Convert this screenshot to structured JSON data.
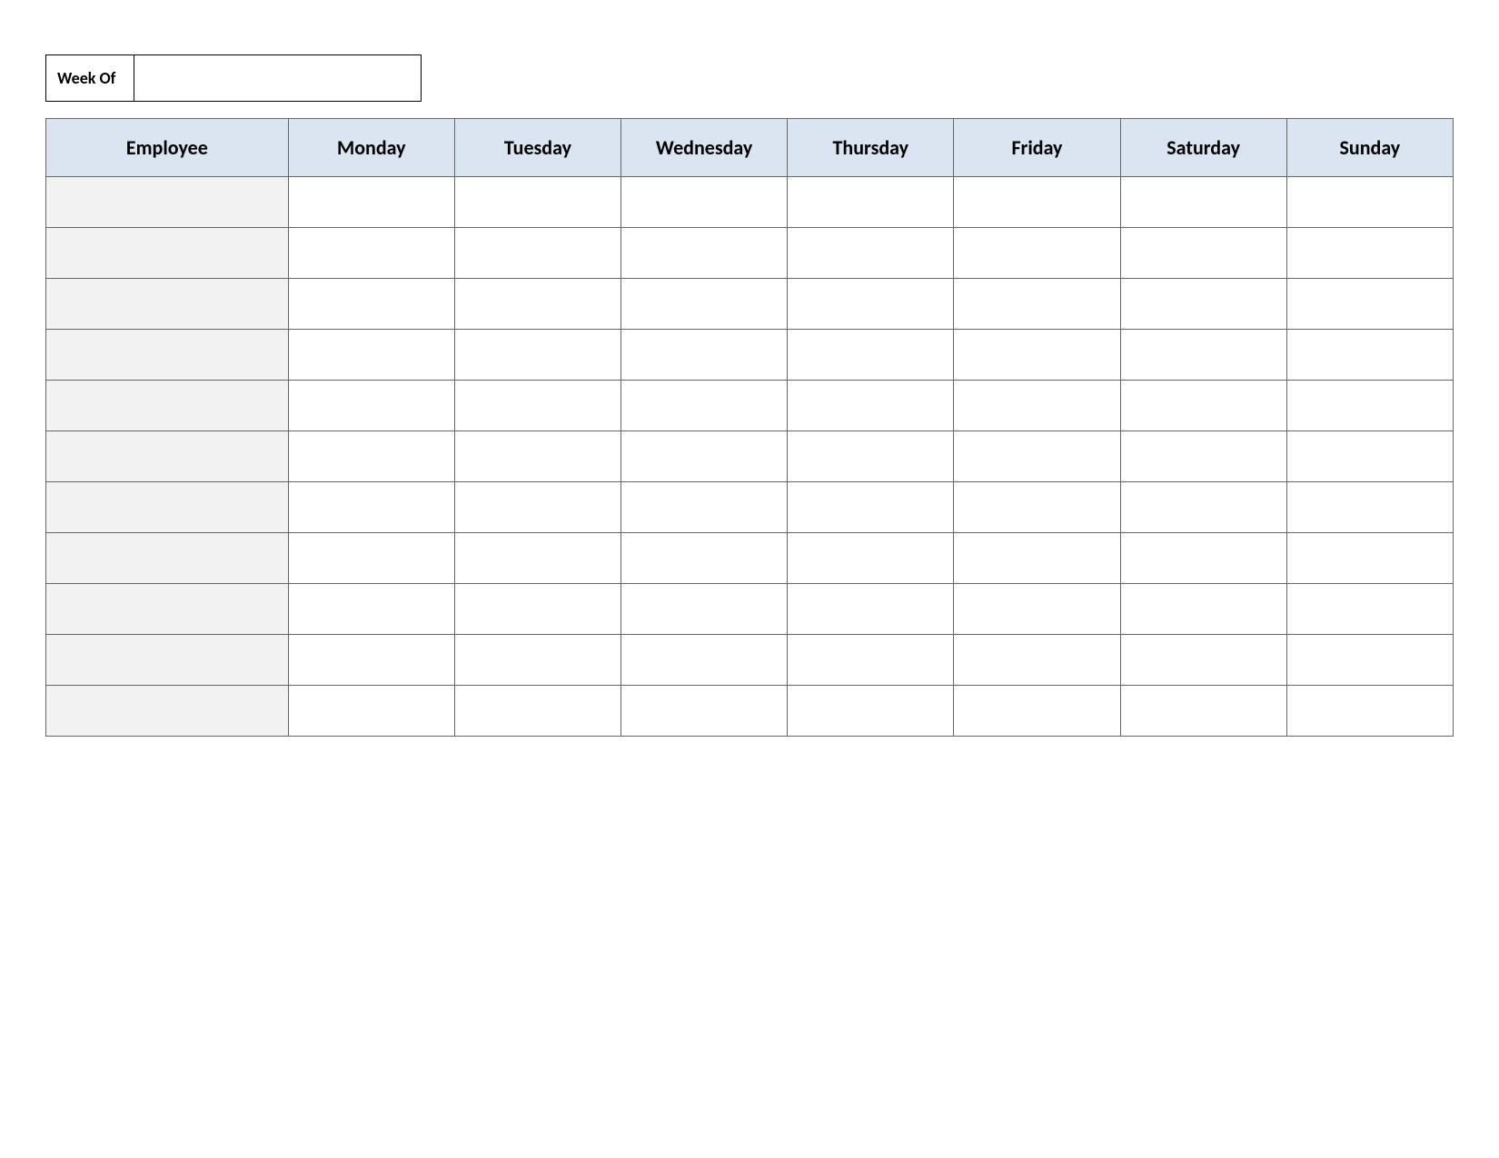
{
  "weekOf": {
    "label": "Week Of",
    "value": ""
  },
  "headers": {
    "employee": "Employee",
    "days": [
      "Monday",
      "Tuesday",
      "Wednesday",
      "Thursday",
      "Friday",
      "Saturday",
      "Sunday"
    ]
  },
  "rows": [
    {
      "employee": "",
      "mon": "",
      "tue": "",
      "wed": "",
      "thu": "",
      "fri": "",
      "sat": "",
      "sun": ""
    },
    {
      "employee": "",
      "mon": "",
      "tue": "",
      "wed": "",
      "thu": "",
      "fri": "",
      "sat": "",
      "sun": ""
    },
    {
      "employee": "",
      "mon": "",
      "tue": "",
      "wed": "",
      "thu": "",
      "fri": "",
      "sat": "",
      "sun": ""
    },
    {
      "employee": "",
      "mon": "",
      "tue": "",
      "wed": "",
      "thu": "",
      "fri": "",
      "sat": "",
      "sun": ""
    },
    {
      "employee": "",
      "mon": "",
      "tue": "",
      "wed": "",
      "thu": "",
      "fri": "",
      "sat": "",
      "sun": ""
    },
    {
      "employee": "",
      "mon": "",
      "tue": "",
      "wed": "",
      "thu": "",
      "fri": "",
      "sat": "",
      "sun": ""
    },
    {
      "employee": "",
      "mon": "",
      "tue": "",
      "wed": "",
      "thu": "",
      "fri": "",
      "sat": "",
      "sun": ""
    },
    {
      "employee": "",
      "mon": "",
      "tue": "",
      "wed": "",
      "thu": "",
      "fri": "",
      "sat": "",
      "sun": ""
    },
    {
      "employee": "",
      "mon": "",
      "tue": "",
      "wed": "",
      "thu": "",
      "fri": "",
      "sat": "",
      "sun": ""
    },
    {
      "employee": "",
      "mon": "",
      "tue": "",
      "wed": "",
      "thu": "",
      "fri": "",
      "sat": "",
      "sun": ""
    },
    {
      "employee": "",
      "mon": "",
      "tue": "",
      "wed": "",
      "thu": "",
      "fri": "",
      "sat": "",
      "sun": ""
    }
  ]
}
